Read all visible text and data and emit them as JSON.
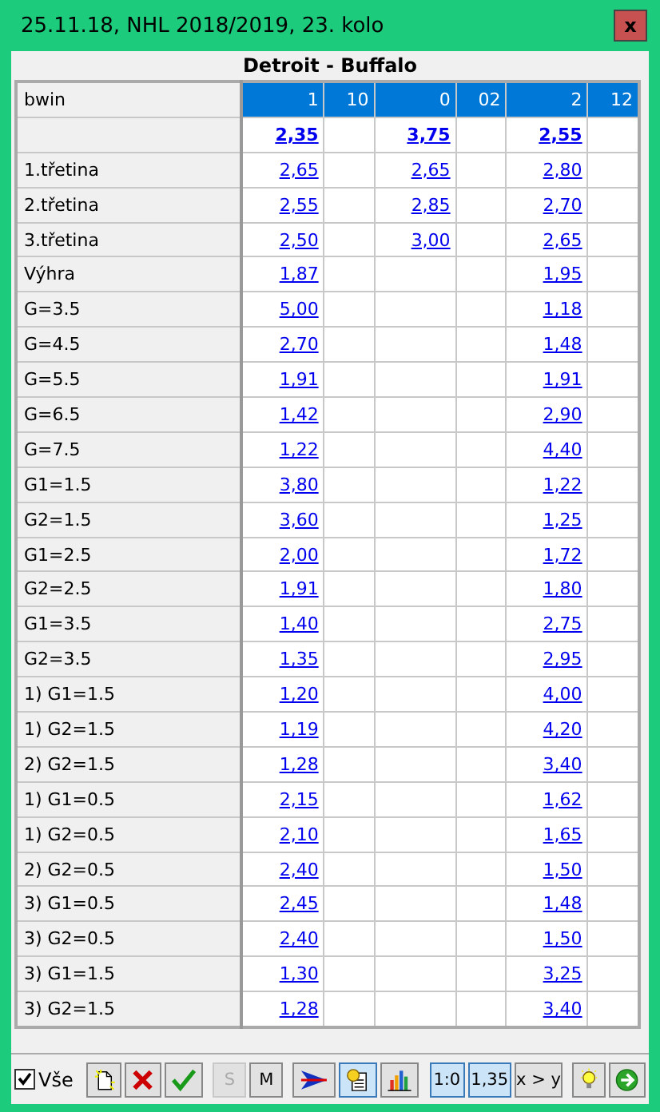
{
  "window": {
    "title": "25.11.18, NHL 2018/2019, 23. kolo",
    "close": "x"
  },
  "match": "Detroit - Buffalo",
  "table": {
    "bookmaker": "bwin",
    "columns": [
      "1",
      "10",
      "0",
      "02",
      "2",
      "12"
    ],
    "rows": [
      {
        "kind": "main",
        "home": "2,35",
        "draw": "3,75",
        "away": "2,55"
      },
      {
        "kind": "line",
        "label": "1.třetina",
        "home": "2,65",
        "draw": "2,65",
        "away": "2,80"
      },
      {
        "kind": "line",
        "label": "2.třetina",
        "home": "2,55",
        "draw": "2,85",
        "away": "2,70"
      },
      {
        "kind": "line",
        "label": "3.třetina",
        "home": "2,50",
        "draw": "3,00",
        "away": "2,65"
      },
      {
        "kind": "line",
        "label": "Výhra",
        "home": "1,87",
        "away": "1,95"
      },
      {
        "kind": "line",
        "label": "G=3.5",
        "home": "5,00",
        "away": "1,18"
      },
      {
        "kind": "line",
        "label": "G=4.5",
        "home": "2,70",
        "away": "1,48"
      },
      {
        "kind": "line",
        "label": "G=5.5",
        "home": "1,91",
        "away": "1,91"
      },
      {
        "kind": "line",
        "label": "G=6.5",
        "home": "1,42",
        "away": "2,90"
      },
      {
        "kind": "line",
        "label": "G=7.5",
        "home": "1,22",
        "away": "4,40"
      },
      {
        "kind": "line",
        "label": "G1=1.5",
        "home": "3,80",
        "away": "1,22"
      },
      {
        "kind": "line",
        "label": "G2=1.5",
        "home": "3,60",
        "away": "1,25"
      },
      {
        "kind": "line",
        "label": "G1=2.5",
        "home": "2,00",
        "away": "1,72"
      },
      {
        "kind": "line",
        "label": "G2=2.5",
        "home": "1,91",
        "away": "1,80"
      },
      {
        "kind": "line",
        "label": "G1=3.5",
        "home": "1,40",
        "away": "2,75"
      },
      {
        "kind": "line",
        "label": "G2=3.5",
        "home": "1,35",
        "away": "2,95"
      },
      {
        "kind": "line",
        "label": "1) G1=1.5",
        "home": "1,20",
        "away": "4,00"
      },
      {
        "kind": "line",
        "label": "1) G2=1.5",
        "home": "1,19",
        "away": "4,20"
      },
      {
        "kind": "line",
        "label": "2) G2=1.5",
        "home": "1,28",
        "away": "3,40"
      },
      {
        "kind": "line",
        "label": "1) G1=0.5",
        "home": "2,15",
        "away": "1,62"
      },
      {
        "kind": "line",
        "label": "1) G2=0.5",
        "home": "2,10",
        "away": "1,65"
      },
      {
        "kind": "line",
        "label": "2) G2=0.5",
        "home": "2,40",
        "away": "1,50"
      },
      {
        "kind": "line",
        "label": "3) G1=0.5",
        "home": "2,45",
        "away": "1,48"
      },
      {
        "kind": "line",
        "label": "3) G2=0.5",
        "home": "2,40",
        "away": "1,50"
      },
      {
        "kind": "line",
        "label": "3) G1=1.5",
        "home": "1,30",
        "away": "3,25"
      },
      {
        "kind": "line",
        "label": "3) G2=1.5",
        "home": "1,28",
        "away": "3,40"
      }
    ]
  },
  "toolbar": {
    "select_all": {
      "label": "Vše",
      "checked": true
    },
    "buttons": [
      {
        "kind": "icon",
        "selected": false,
        "disabled": false
      },
      {
        "kind": "icon",
        "selected": false,
        "disabled": false
      },
      {
        "kind": "icon",
        "selected": false,
        "disabled": false
      },
      {
        "kind": "text",
        "label": "S",
        "selected": false,
        "disabled": true
      },
      {
        "kind": "text",
        "label": "M",
        "selected": false,
        "disabled": false
      },
      {
        "kind": "icon",
        "selected": false,
        "disabled": false
      },
      {
        "kind": "icon",
        "selected": true,
        "disabled": false
      },
      {
        "kind": "icon",
        "selected": false,
        "disabled": false
      },
      {
        "kind": "text",
        "label": "1:0",
        "selected": true,
        "disabled": false
      },
      {
        "kind": "text",
        "label": "1,35",
        "selected": true,
        "disabled": false
      },
      {
        "kind": "text",
        "label": "x > y",
        "selected": false,
        "disabled": false
      },
      {
        "kind": "icon",
        "selected": false,
        "disabled": false
      },
      {
        "kind": "icon",
        "selected": false,
        "disabled": false
      }
    ]
  }
}
